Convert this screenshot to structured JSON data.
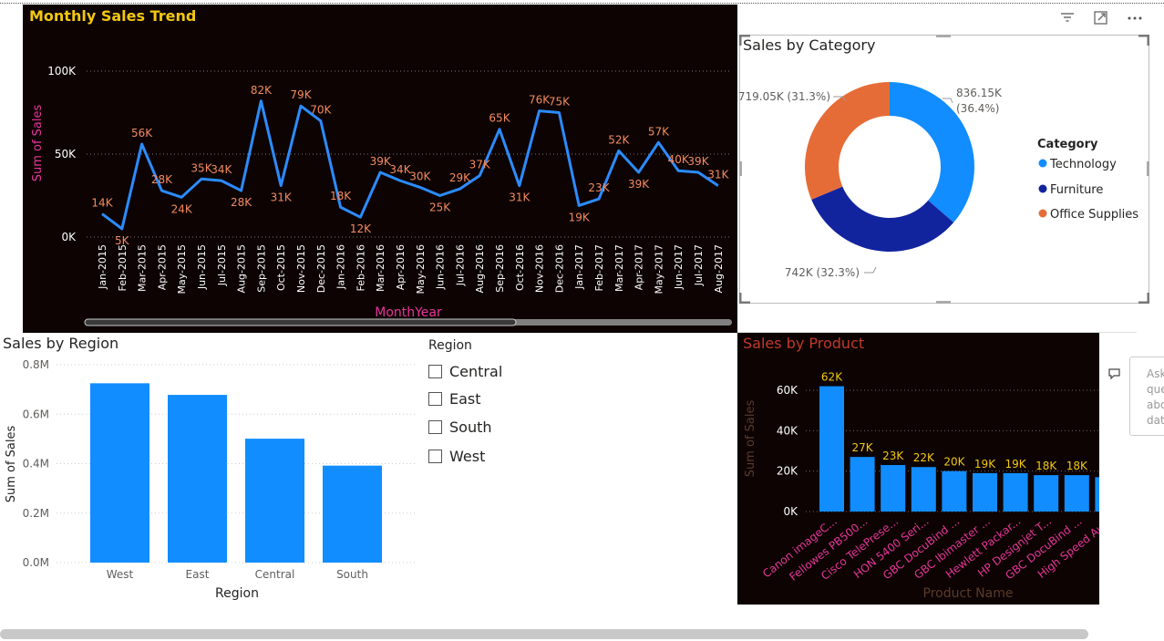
{
  "colors": {
    "line": "#2b8cff",
    "orange_text": "#f28b5f",
    "title_gold": "#f2c811",
    "axis_pink": "#e8359a",
    "tech": "#118dff",
    "furniture": "#12239e",
    "office": "#e66c37",
    "product_label": "#f2c811"
  },
  "monthly_trend": {
    "title": "Monthly Sales Trend",
    "ylabel": "Sum of Sales",
    "xlabel": "MonthYear",
    "y_ticks": [
      "100K",
      "50K",
      "0K"
    ]
  },
  "category": {
    "title": "Sales by Category",
    "legend_title": "Category",
    "legend": [
      "Technology",
      "Furniture",
      "Office Supplies"
    ],
    "labels": {
      "technology_1": "836.15K",
      "technology_2": "(36.4%)",
      "furniture": "742K (32.3%)",
      "office": "719.05K (31.3%)"
    }
  },
  "region_chart": {
    "title": "Sales by Region",
    "ylabel": "Sum of Sales",
    "xlabel": "Region",
    "y_ticks": [
      "0.8M",
      "0.6M",
      "0.4M",
      "0.2M",
      "0.0M"
    ]
  },
  "region_slicer": {
    "title": "Region",
    "items": [
      "Central",
      "East",
      "South",
      "West"
    ]
  },
  "product_chart": {
    "title": "Sales by Product",
    "ylabel": "Sum of Sales",
    "xlabel": "Product Name",
    "y_ticks": [
      "60K",
      "40K",
      "20K",
      "0K"
    ]
  },
  "qa": {
    "lines": [
      "Ask",
      "que",
      "abo",
      "dat"
    ]
  },
  "chart_data": [
    {
      "type": "line",
      "title": "Monthly Sales Trend",
      "xlabel": "MonthYear",
      "ylabel": "Sum of Sales",
      "ylim": [
        0,
        100000
      ],
      "x": [
        "Jan-2015",
        "Feb-2015",
        "Mar-2015",
        "Apr-2015",
        "May-2015",
        "Jun-2015",
        "Jul-2015",
        "Aug-2015",
        "Sep-2015",
        "Oct-2015",
        "Nov-2015",
        "Dec-2015",
        "Jan-2016",
        "Feb-2016",
        "Mar-2016",
        "Apr-2016",
        "May-2016",
        "Jun-2016",
        "Jul-2016",
        "Aug-2016",
        "Sep-2016",
        "Oct-2016",
        "Nov-2016",
        "Dec-2016",
        "Jan-2017",
        "Feb-2017",
        "Mar-2017",
        "Apr-2017",
        "May-2017",
        "Jun-2017",
        "Jul-2017",
        "Aug-2017"
      ],
      "values": [
        14000,
        5000,
        56000,
        28000,
        24000,
        35000,
        34000,
        28000,
        82000,
        31000,
        79000,
        70000,
        18000,
        12000,
        39000,
        34000,
        30000,
        25000,
        29000,
        37000,
        65000,
        31000,
        76000,
        75000,
        19000,
        23000,
        52000,
        39000,
        57000,
        40000,
        39000,
        31000
      ],
      "data_labels": [
        "14K",
        "5K",
        "56K",
        "28K",
        "24K",
        "35K",
        "34K",
        "28K",
        "82K",
        "31K",
        "79K",
        "70K",
        "18K",
        "12K",
        "39K",
        "34K",
        "30K",
        "25K",
        "29K",
        "37K",
        "65K",
        "31K",
        "76K",
        "75K",
        "19K",
        "23K",
        "52K",
        "39K",
        "57K",
        "40K",
        "39K",
        "31K"
      ]
    },
    {
      "type": "pie",
      "title": "Sales by Category",
      "categories": [
        "Technology",
        "Furniture",
        "Office Supplies"
      ],
      "values": [
        836150,
        742000,
        719050
      ],
      "percent": [
        36.4,
        32.3,
        31.3
      ]
    },
    {
      "type": "bar",
      "title": "Sales by Region",
      "xlabel": "Region",
      "ylabel": "Sum of Sales",
      "ylim": [
        0,
        800000
      ],
      "categories": [
        "West",
        "East",
        "Central",
        "South"
      ],
      "values": [
        725000,
        678000,
        501000,
        392000
      ]
    },
    {
      "type": "bar",
      "title": "Sales by Product",
      "xlabel": "Product Name",
      "ylabel": "Sum of Sales",
      "ylim": [
        0,
        60000
      ],
      "categories": [
        "Canon imageC...",
        "Fellowes PB500...",
        "Cisco TelePrese...",
        "HON 5400 Seri...",
        "GBC DocuBind ...",
        "GBC Ibimaster ...",
        "Hewlett Packar...",
        "HP Designjet T...",
        "GBC DocuBind ...",
        "High Speed Au..."
      ],
      "values": [
        62000,
        27000,
        23000,
        22000,
        20000,
        19000,
        19000,
        18000,
        18000,
        17000
      ],
      "data_labels": [
        "62K",
        "27K",
        "23K",
        "22K",
        "20K",
        "19K",
        "19K",
        "18K",
        "18K",
        ""
      ]
    }
  ]
}
